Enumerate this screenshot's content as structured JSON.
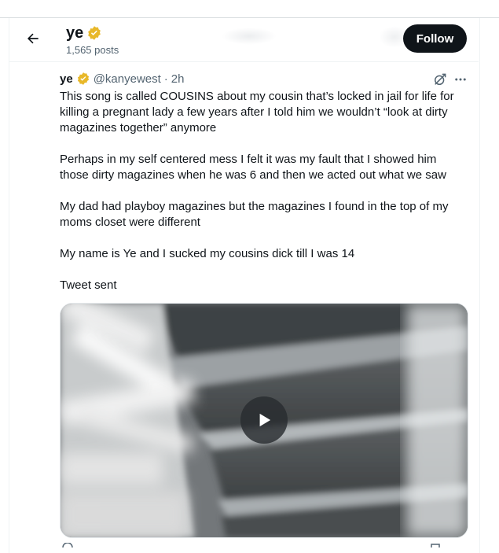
{
  "header": {
    "back_label": "Back",
    "name": "ye",
    "posts_count": "1,565 posts",
    "follow_label": "Follow"
  },
  "tweet": {
    "name": "ye",
    "handle": "@kanyewest",
    "separator": "·",
    "time": "2h",
    "paragraphs": [
      "This song is called COUSINS about my cousin that’s locked in jail for life for killing a pregnant lady a few years after I told him we wouldn’t “look at dirty magazines together” anymore",
      "Perhaps in my self centered mess I felt it was my fault that I showed him those dirty magazines when he was 6 and then we acted out what we saw",
      "My dad had playboy magazines but the magazines I found in the top of my moms closet were different",
      "My name is Ye and I sucked my cousins dick till I was 14",
      "Tweet sent"
    ],
    "media": {
      "type": "video",
      "play_icon": "play-icon"
    }
  },
  "colors": {
    "verified_gold": "#e8b829",
    "text_primary": "#0f1419",
    "text_secondary": "#536471",
    "follow_bg": "#0f1419"
  }
}
